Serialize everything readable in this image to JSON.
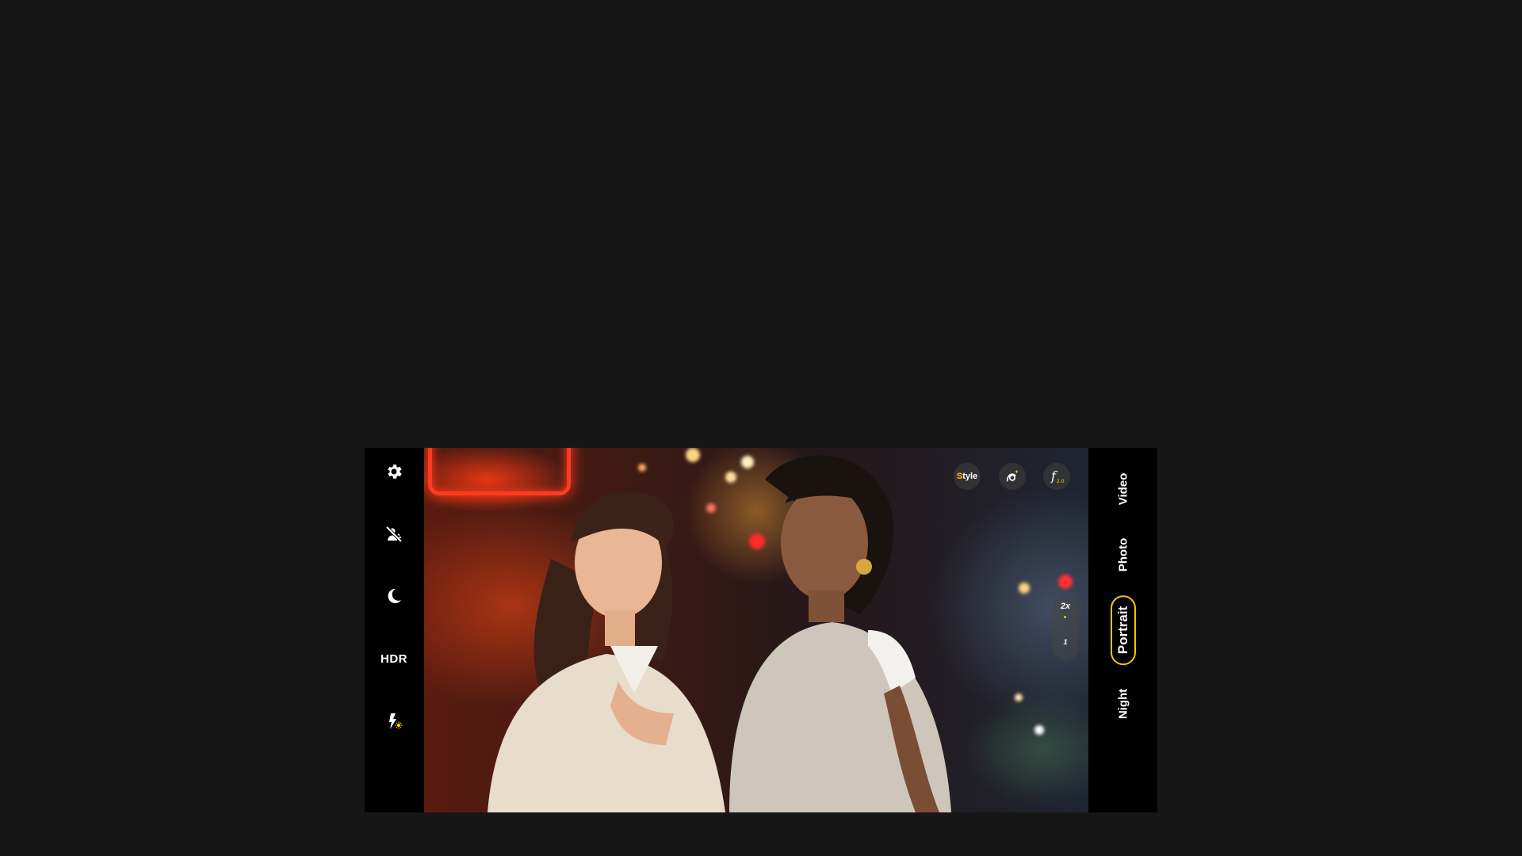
{
  "left_controls": [
    {
      "name": "settings-button",
      "icon": "gear-icon"
    },
    {
      "name": "beauty-off-button",
      "icon": "face-off-icon"
    },
    {
      "name": "night-mode-button",
      "icon": "moon-icon"
    },
    {
      "name": "hdr-button",
      "label": "HDR"
    },
    {
      "name": "flash-button",
      "icon": "flash-auto-icon"
    }
  ],
  "overlay": {
    "style_prefix": "S",
    "style_rest": "tyle",
    "portrait_effect_icon": "portrait-sparkle-icon",
    "aperture_icon": "aperture-f-icon",
    "aperture_value": "2.0"
  },
  "zoom": {
    "option_1": "2x",
    "option_2": "1"
  },
  "modes": [
    "Video",
    "Photo",
    "Portrait",
    "Night"
  ],
  "active_mode": "Portrait",
  "colors": {
    "accent": "#f5c400",
    "background": "#161616",
    "bar": "#000000"
  }
}
